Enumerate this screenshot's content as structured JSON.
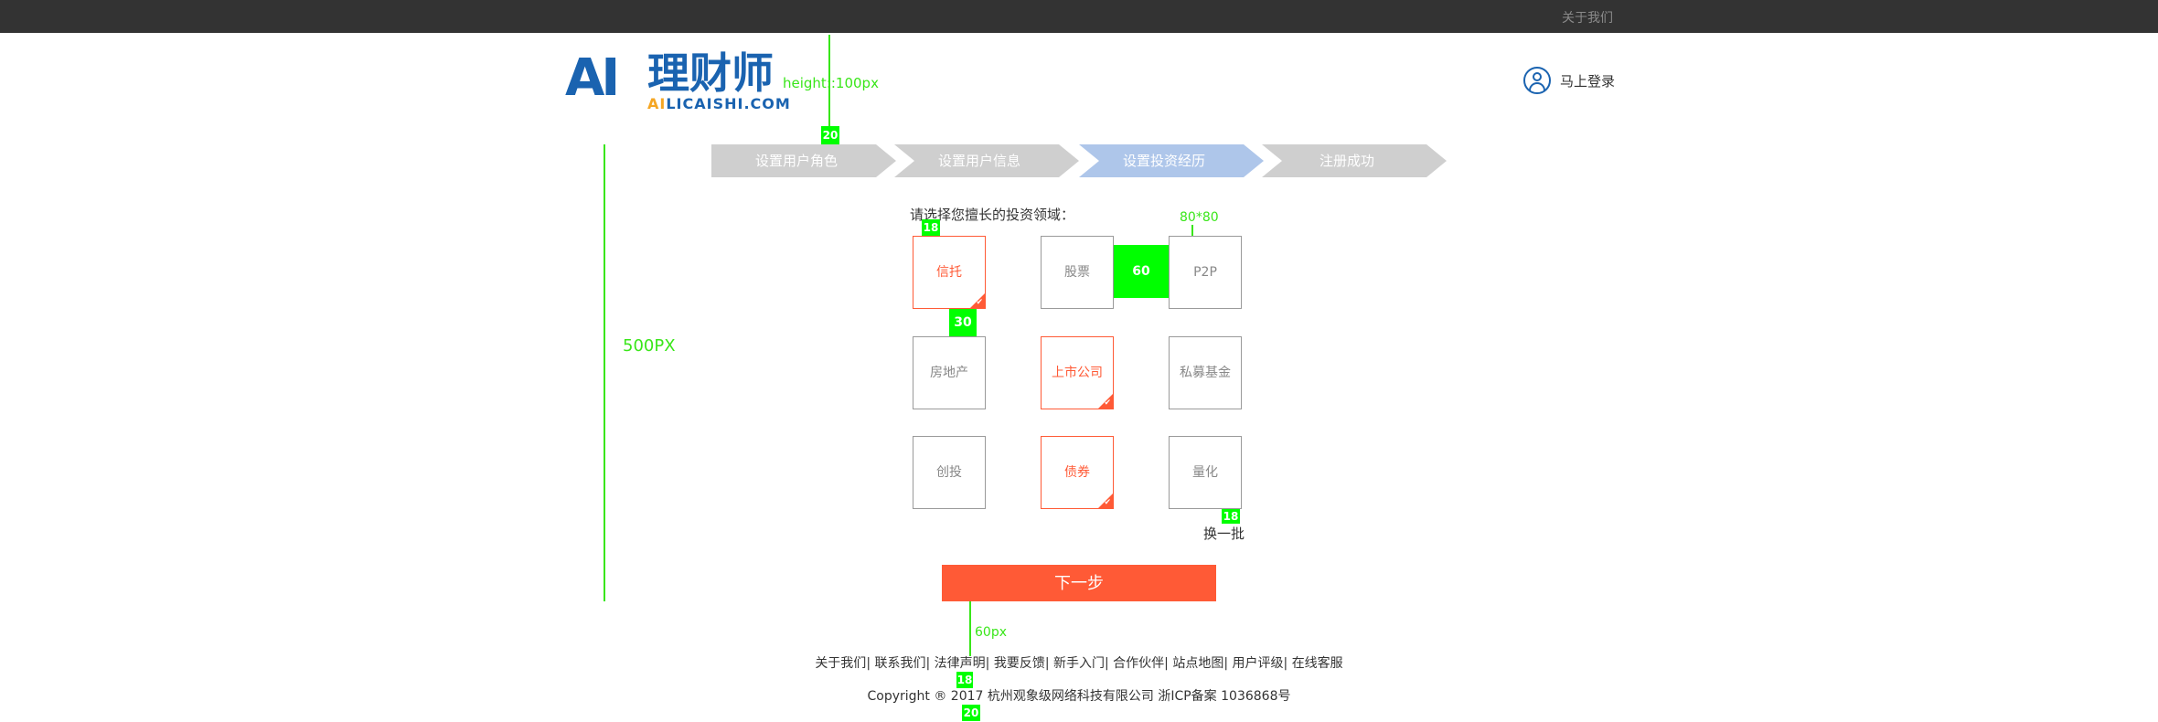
{
  "topbar": {
    "about_link": "关于我们"
  },
  "logo": {
    "mark": "AI",
    "cn": "理财师",
    "sub_ai": "AI",
    "sub_rest": "LICAISHI.COM"
  },
  "login": {
    "label": "马上登录",
    "icon": "user-circle-icon"
  },
  "steps": [
    {
      "label": "设置用户角色",
      "active": false
    },
    {
      "label": "设置用户信息",
      "active": false
    },
    {
      "label": "设置投资经历",
      "active": true
    },
    {
      "label": "注册成功",
      "active": false
    }
  ],
  "prompt": "请选择您擅长的投资领域：",
  "tiles": [
    {
      "label": "信托",
      "selected": true
    },
    {
      "label": "股票",
      "selected": false
    },
    {
      "label": "P2P",
      "selected": false
    },
    {
      "label": "房地产",
      "selected": false
    },
    {
      "label": "上市公司",
      "selected": true
    },
    {
      "label": "私募基金",
      "selected": false
    },
    {
      "label": "创投",
      "selected": false
    },
    {
      "label": "债券",
      "selected": true
    },
    {
      "label": "量化",
      "selected": false
    }
  ],
  "refresh_label": "换一批",
  "next_label": "下一步",
  "footer": {
    "links": [
      "关于我们",
      "联系我们",
      "法律声明",
      "我要反馈",
      "新手入门",
      "合作伙伴",
      "站点地图",
      "用户评级",
      "在线客服"
    ],
    "copyright": "Copyright ® 2017 杭州观象级网络科技有限公司 浙ICP备案 1036868号"
  },
  "annotations": {
    "header_height": "height::100px",
    "gap_logo_steps": "20",
    "content_height": "500PX",
    "prompt_gap": "18",
    "tile_size": "80*80",
    "tile_hgap": "60",
    "tile_vgap": "30",
    "refresh_gap": "18",
    "footer_gap": "60px",
    "links_gap": "18",
    "bottom_gap": "20"
  },
  "colors": {
    "accent": "#ff5a36",
    "brand": "#1a63b0",
    "step_active": "#aec6ea",
    "step_default": "#cfcfcf",
    "annotation": "#39e619"
  }
}
